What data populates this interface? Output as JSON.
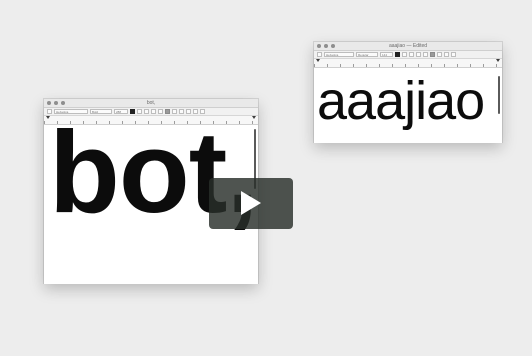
{
  "windows": [
    {
      "id": "left",
      "title": "bot,",
      "toolbar": {
        "font_family": "Helvetica",
        "font_style": "Bold",
        "font_size": "288"
      },
      "document_text": "bot,"
    },
    {
      "id": "right",
      "title": "aaajiao — Edited",
      "toolbar": {
        "font_family": "Helvetica",
        "font_style": "Regular",
        "font_size": "144"
      },
      "document_text": "aaajiao"
    }
  ],
  "video": {
    "play_icon": "play-icon",
    "overlay_color": "#2e3430"
  }
}
